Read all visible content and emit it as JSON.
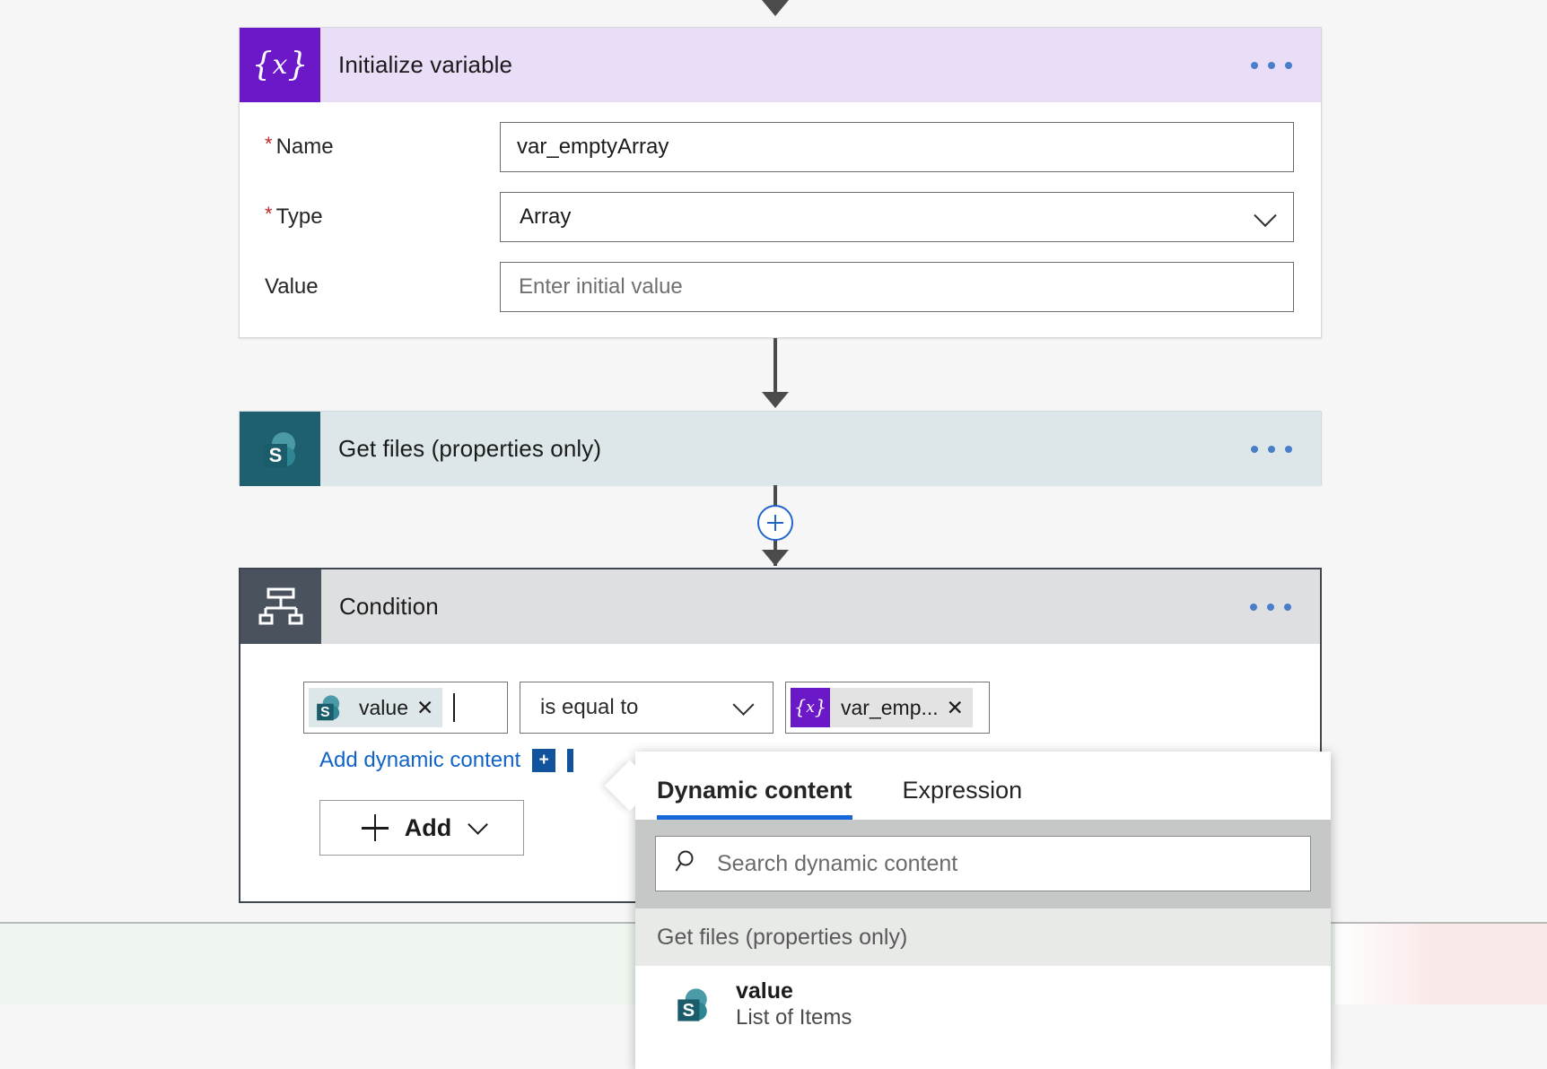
{
  "cards": {
    "initialize_variable": {
      "title": "Initialize variable",
      "icon": "variable-icon",
      "menu": "more-commands",
      "fields": [
        {
          "label": "Name",
          "required": true,
          "value": "var_emptyArray",
          "placeholder": ""
        },
        {
          "label": "Type",
          "required": true,
          "value": "Array",
          "placeholder": ""
        },
        {
          "label": "Value",
          "required": false,
          "value": "",
          "placeholder": "Enter initial value"
        }
      ]
    },
    "get_files": {
      "title": "Get files (properties only)",
      "icon": "sharepoint-icon"
    },
    "condition": {
      "title": "Condition",
      "icon": "condition-icon",
      "left_token": {
        "text": "value",
        "icon": "sharepoint-icon",
        "remove": "✕"
      },
      "operator": "is equal to",
      "right_token": {
        "text": "var_emp...",
        "icon": "variable-icon",
        "remove": "✕"
      },
      "add_dynamic_content": "Add dynamic content",
      "add_dynamic_badge": "+",
      "add_button": "Add"
    }
  },
  "branches": {
    "if_yes_color": "#eef6ef",
    "if_no_color": "#fae9e9"
  },
  "dynamic_content_panel": {
    "tabs": [
      {
        "label": "Dynamic content",
        "active": true
      },
      {
        "label": "Expression",
        "active": false
      }
    ],
    "search": {
      "placeholder": "Search dynamic content",
      "value": "",
      "icon": "search-icon"
    },
    "groups": [
      {
        "header": "Get files (properties only)",
        "items": [
          {
            "name": "value",
            "subtitle": "List of Items",
            "icon": "sharepoint-icon"
          }
        ]
      }
    ]
  },
  "colors": {
    "variable_purple": "#6b18c9",
    "sharepoint_teal": "#1f6070",
    "condition_slate": "#4a525e",
    "link_blue": "#1163c7",
    "tab_underline": "#1668d8"
  }
}
